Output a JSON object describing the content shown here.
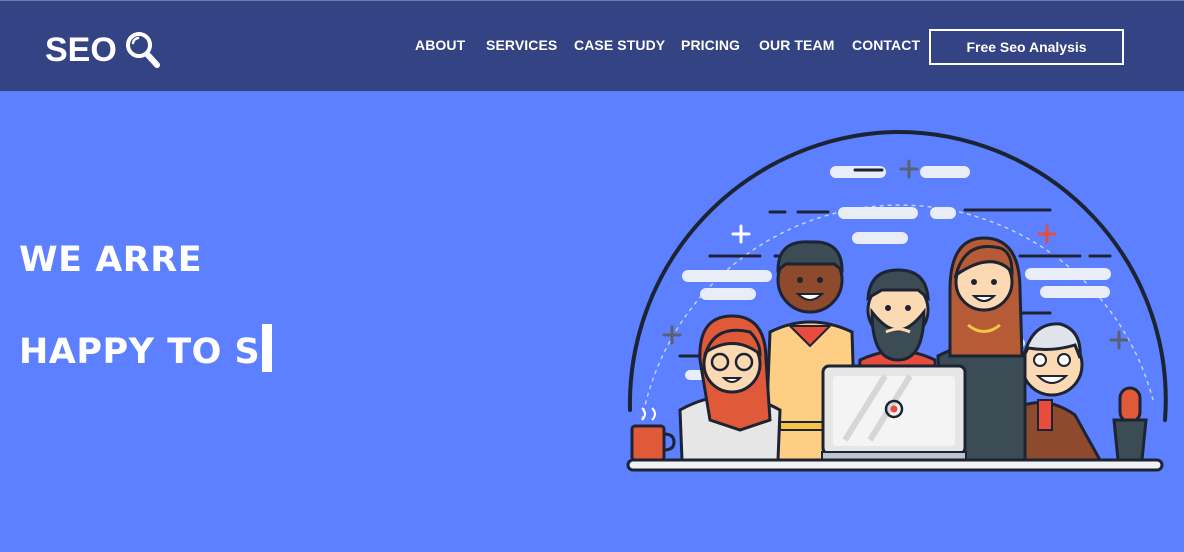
{
  "brand": {
    "name": "SEO",
    "icon": "magnifier-icon"
  },
  "nav": {
    "items": [
      {
        "label": "ABOUT"
      },
      {
        "label": "SERVICES"
      },
      {
        "label": "CASE STUDY"
      },
      {
        "label": "PRICING"
      },
      {
        "label": "OUR TEAM"
      },
      {
        "label": "CONTACT"
      }
    ],
    "cta_label": "Free Seo Analysis"
  },
  "hero": {
    "line1": "WE ARRE",
    "line2": "HAPPY TO S"
  },
  "colors": {
    "navbar": "#344383",
    "background": "#5c80ff",
    "text": "#ffffff"
  }
}
